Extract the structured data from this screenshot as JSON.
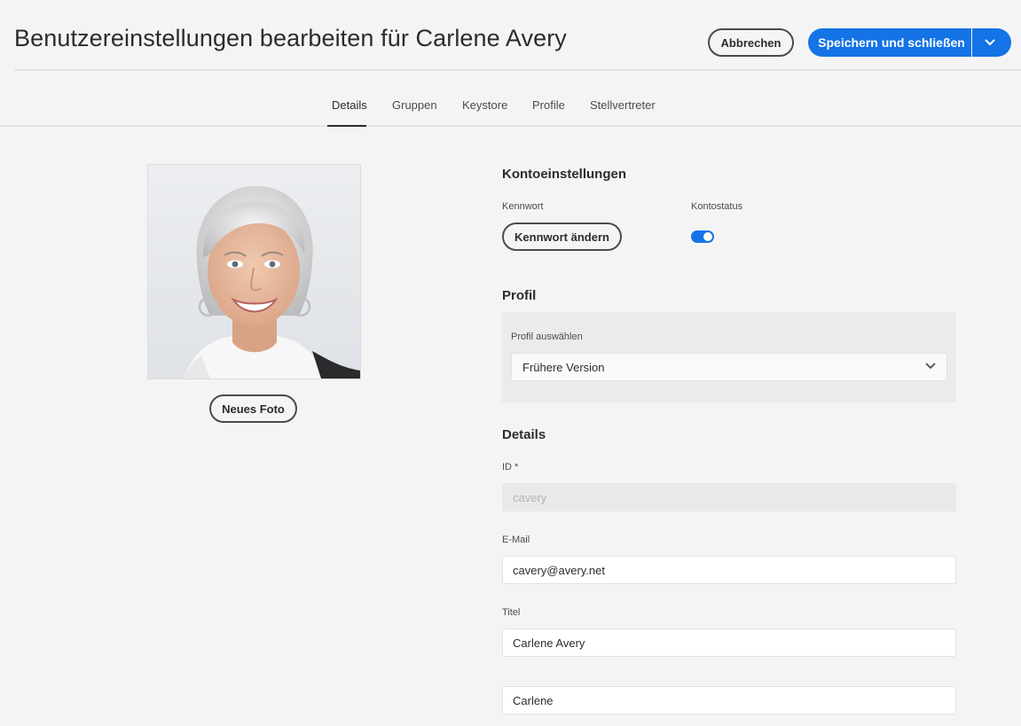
{
  "header": {
    "title": "Benutzereinstellungen bearbeiten für Carlene Avery",
    "cancel_label": "Abbrechen",
    "save_label": "Speichern und schließen"
  },
  "tabs": [
    {
      "label": "Details",
      "active": true
    },
    {
      "label": "Gruppen",
      "active": false
    },
    {
      "label": "Keystore",
      "active": false
    },
    {
      "label": "Profile",
      "active": false
    },
    {
      "label": "Stellvertreter",
      "active": false
    }
  ],
  "photo": {
    "new_photo_label": "Neues Foto"
  },
  "account": {
    "heading": "Kontoeinstellungen",
    "password_label": "Kennwort",
    "change_password_label": "Kennwort ändern",
    "status_label": "Kontostatus",
    "status_enabled": true
  },
  "profile": {
    "heading": "Profil",
    "select_label": "Profil auswählen",
    "selected_value": "Frühere Version"
  },
  "details": {
    "heading": "Details",
    "id_label": "ID *",
    "id_value": "cavery",
    "email_label": "E-Mail",
    "email_value": "cavery@avery.net",
    "title_label": "Titel",
    "title_value": "Carlene Avery",
    "first_name_value": "Carlene"
  },
  "colors": {
    "accent": "#1473e6",
    "background": "#f4f4f4",
    "text": "#2c2c2c"
  }
}
